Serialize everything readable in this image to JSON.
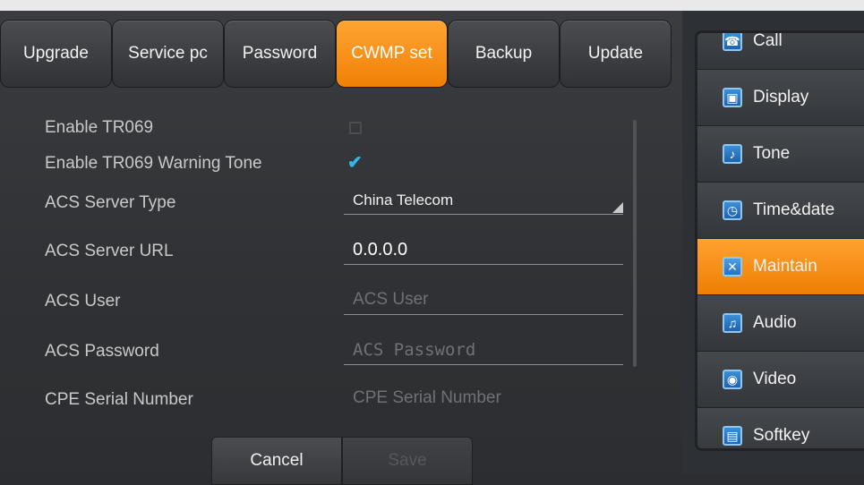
{
  "tabs": [
    {
      "label": "Upgrade"
    },
    {
      "label": "Service pc"
    },
    {
      "label": "Password"
    },
    {
      "label": "CWMP set"
    },
    {
      "label": "Backup"
    },
    {
      "label": "Update"
    }
  ],
  "active_tab": "CWMP set",
  "form": {
    "enable_tr069": {
      "label": "Enable TR069",
      "checked": false
    },
    "enable_tr069_warning_tone": {
      "label": "Enable TR069 Warning Tone",
      "checked": true
    },
    "acs_server_type": {
      "label": "ACS Server Type",
      "value": "China Telecom"
    },
    "acs_server_url": {
      "label": "ACS Server URL",
      "value": "0.0.0.0"
    },
    "acs_user": {
      "label": "ACS User",
      "placeholder": "ACS User"
    },
    "acs_password": {
      "label": "ACS Password",
      "placeholder": "ACS Password"
    },
    "cpe_serial_number": {
      "label": "CPE Serial Number",
      "placeholder": "CPE Serial Number"
    }
  },
  "buttons": {
    "cancel": "Cancel",
    "save": "Save"
  },
  "sidebar": {
    "items": [
      {
        "label": "Call",
        "icon": "phone-icon",
        "glyph": "☎"
      },
      {
        "label": "Display",
        "icon": "display-icon",
        "glyph": "▣"
      },
      {
        "label": "Tone",
        "icon": "speaker-icon",
        "glyph": "♪"
      },
      {
        "label": "Time&date",
        "icon": "clock-icon",
        "glyph": "◷"
      },
      {
        "label": "Maintain",
        "icon": "tools-icon",
        "glyph": "✕"
      },
      {
        "label": "Audio",
        "icon": "microphone-icon",
        "glyph": "♫"
      },
      {
        "label": "Video",
        "icon": "camera-icon",
        "glyph": "◉"
      },
      {
        "label": "Softkey",
        "icon": "softkey-icon",
        "glyph": "▤"
      }
    ],
    "active": "Maintain"
  },
  "colors": {
    "accent_orange": "#f59214",
    "checkbox_blue": "#33b5e5"
  }
}
